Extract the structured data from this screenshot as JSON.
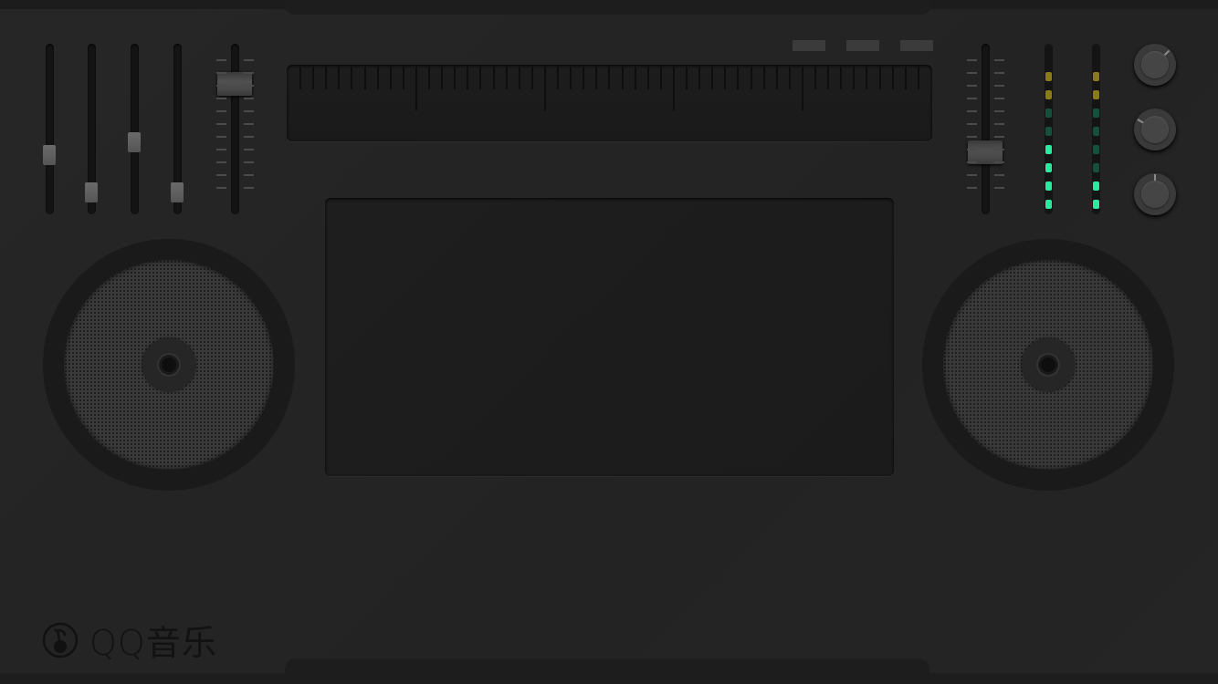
{
  "brand": {
    "logo_text": "QQ音乐"
  },
  "colors": {
    "meter_yellow": "#8a7a1a",
    "meter_green_on": "#2ee8a0",
    "meter_green_off": "#14503c",
    "knob_indicator": "#8a8a8a"
  },
  "channel_faders": [
    0.33,
    0.08,
    0.41,
    0.08
  ],
  "left_pitch_fader": 0.81,
  "right_pitch_fader": 0.34,
  "top_buttons": [
    "button-1",
    "button-2",
    "button-3"
  ],
  "level_meters": [
    {
      "segments": [
        "yellow",
        "yellow",
        "green-off",
        "green-off",
        "green-on",
        "green-on",
        "green-on",
        "green-on"
      ]
    },
    {
      "segments": [
        "yellow",
        "yellow",
        "green-off",
        "green-off",
        "green-off",
        "green-off",
        "green-on",
        "green-on"
      ]
    }
  ],
  "knobs": [
    {
      "angle_deg": 45
    },
    {
      "angle_deg": -60
    },
    {
      "angle_deg": 0
    }
  ],
  "turntables": [
    "left-deck",
    "right-deck"
  ]
}
